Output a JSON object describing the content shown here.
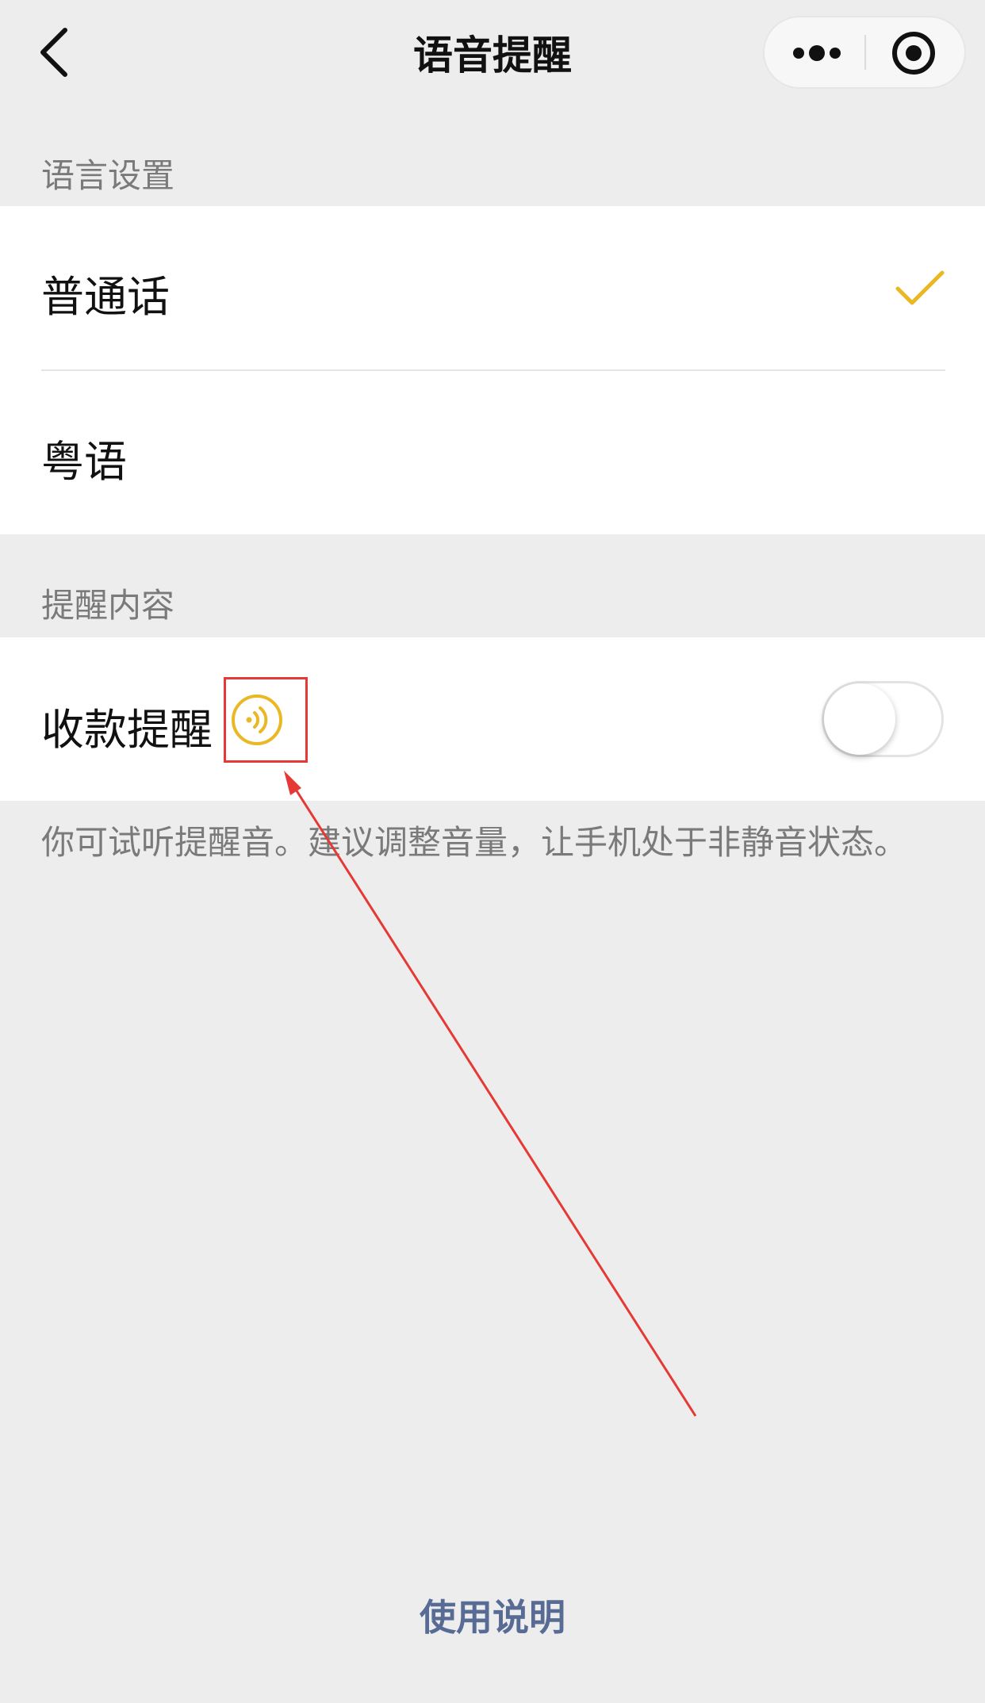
{
  "header": {
    "title": "语音提醒",
    "back_icon": "chevron-left-icon",
    "more_icon": "more-dots-icon",
    "close_icon": "target-close-icon"
  },
  "language_section": {
    "title": "语言设置",
    "options": [
      {
        "label": "普通话",
        "selected": true
      },
      {
        "label": "粤语",
        "selected": false
      }
    ],
    "check_icon": "checkmark-icon"
  },
  "remind_section": {
    "title": "提醒内容",
    "items": [
      {
        "label": "收款提醒",
        "preview_icon": "speaker-play-icon",
        "enabled": false
      }
    ]
  },
  "hint": "你可试听提醒音。建议调整音量，让手机处于非静音状态。",
  "footer": {
    "help_link": "使用说明"
  },
  "colors": {
    "background": "#ededed",
    "accent_gold": "#e9b824",
    "link_blue": "#576b95",
    "annotation_red": "#e53935"
  }
}
